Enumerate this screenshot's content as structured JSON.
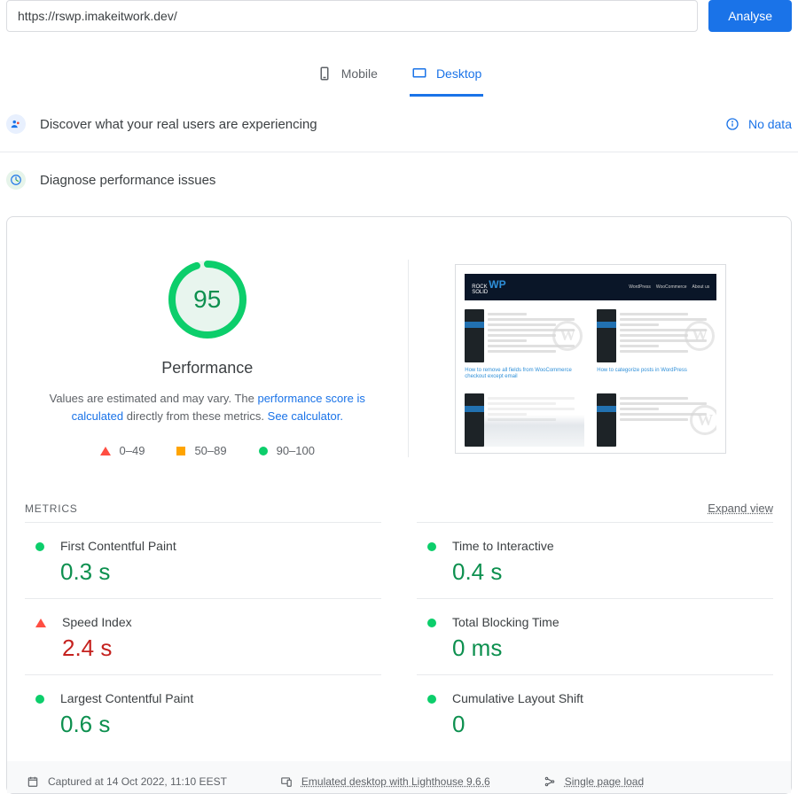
{
  "input": {
    "url": "https://rswp.imakeitwork.dev/",
    "analyse_label": "Analyse"
  },
  "tabs": {
    "mobile": "Mobile",
    "desktop": "Desktop"
  },
  "discover": {
    "title": "Discover what your real users are experiencing",
    "nodata": "No data"
  },
  "diagnose": {
    "title": "Diagnose performance issues"
  },
  "gauge": {
    "score": "95",
    "label": "Performance",
    "note_pre": "Values are estimated and may vary. The ",
    "note_link1": "performance score is calculated",
    "note_mid": " directly from these metrics. ",
    "note_link2": "See calculator."
  },
  "legend": {
    "r1": "0–49",
    "r2": "50–89",
    "r3": "90–100"
  },
  "screenshot": {
    "logo_top": "ROCK",
    "logo_bot": "SOLID",
    "logo_wp": "WP",
    "nav1": "WordPress",
    "nav2": "WooCommerce",
    "nav3": "About us",
    "cap1": "How to remove all fields from WooCommerce checkout except email",
    "cap2": "How to categorize posts in WordPress"
  },
  "metrics_head": {
    "label": "METRICS",
    "expand": "Expand view"
  },
  "metrics": [
    {
      "name": "First Contentful Paint",
      "value": "0.3 s",
      "status": "green"
    },
    {
      "name": "Time to Interactive",
      "value": "0.4 s",
      "status": "green"
    },
    {
      "name": "Speed Index",
      "value": "2.4 s",
      "status": "red"
    },
    {
      "name": "Total Blocking Time",
      "value": "0 ms",
      "status": "green"
    },
    {
      "name": "Largest Contentful Paint",
      "value": "0.6 s",
      "status": "green"
    },
    {
      "name": "Cumulative Layout Shift",
      "value": "0",
      "status": "green"
    }
  ],
  "footer": {
    "captured": "Captured at 14 Oct 2022, 11:10 EEST",
    "emulated": "Emulated desktop with Lighthouse 9.6.6",
    "single": "Single page load"
  }
}
